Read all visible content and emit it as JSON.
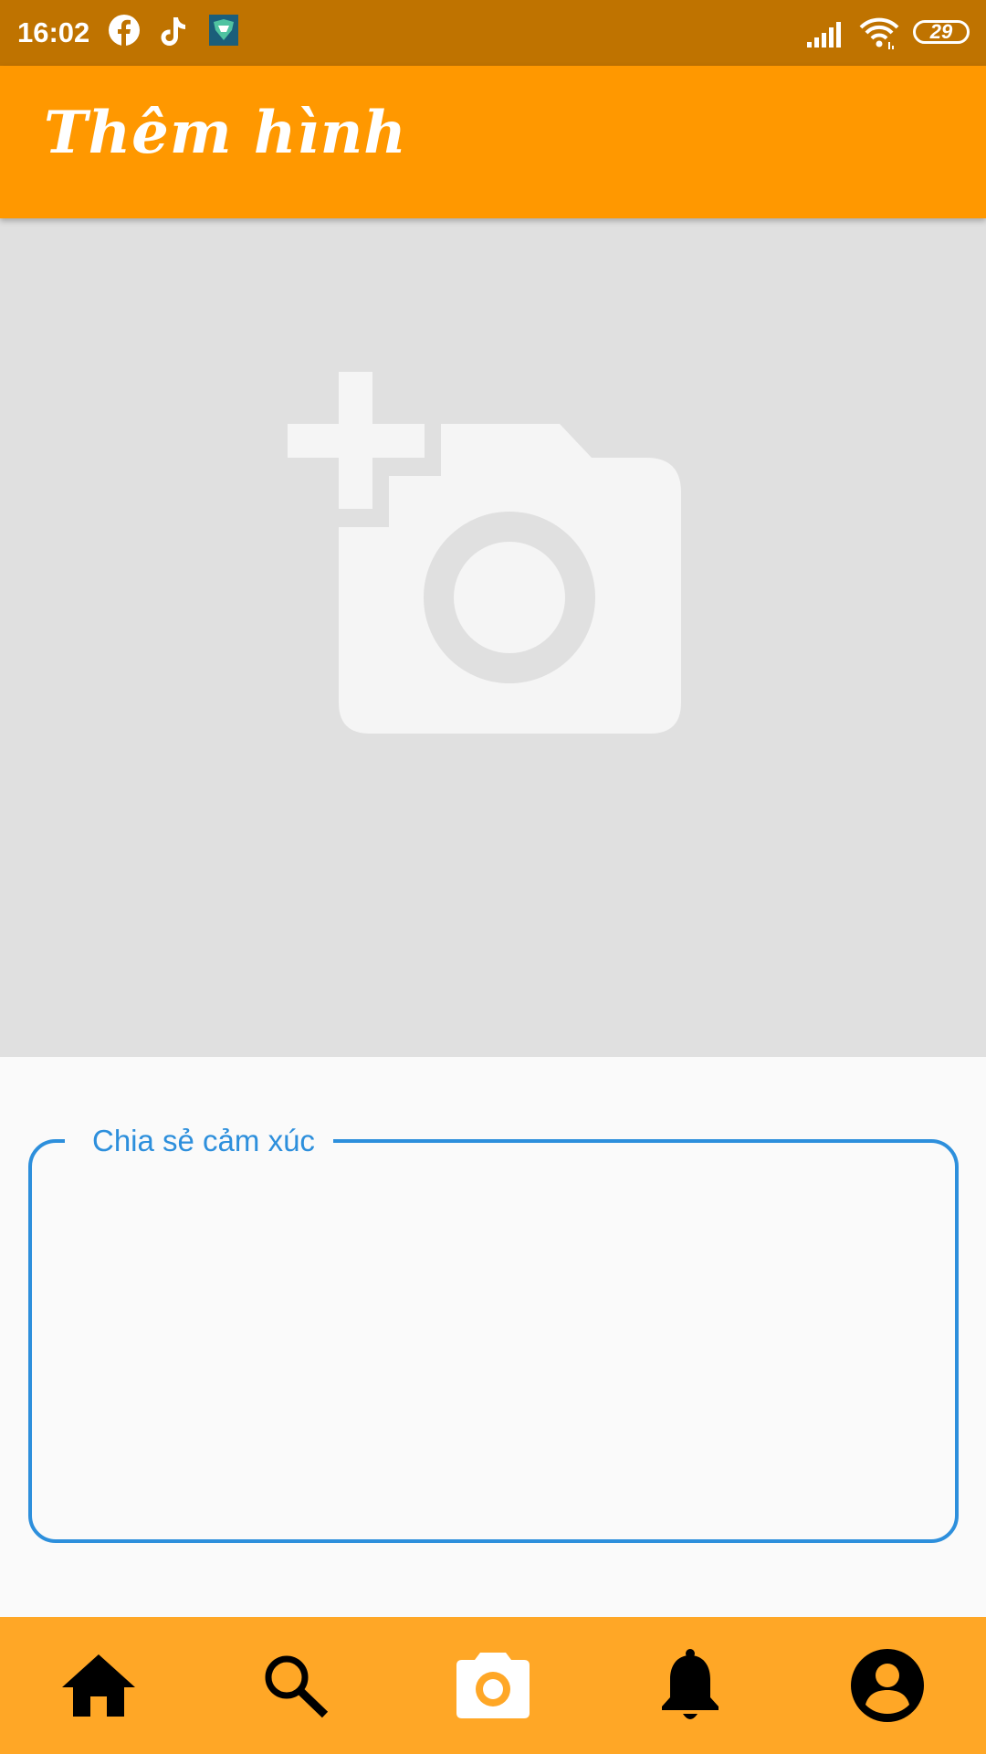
{
  "status_bar": {
    "time": "16:02",
    "battery": "29",
    "notification_icons": [
      "facebook-icon",
      "tiktok-icon",
      "app-badge-icon"
    ],
    "system_icons": [
      "signal-icon",
      "wifi-icon",
      "battery-icon"
    ]
  },
  "app_bar": {
    "title": "Thêm hình"
  },
  "image_picker": {
    "icon": "add-photo-icon"
  },
  "caption": {
    "label": "Chia sẻ cảm xúc",
    "value": ""
  },
  "bottom_nav": {
    "items": [
      {
        "icon": "home-icon"
      },
      {
        "icon": "search-icon"
      },
      {
        "icon": "camera-icon",
        "active": true
      },
      {
        "icon": "bell-icon"
      },
      {
        "icon": "account-icon"
      }
    ]
  },
  "colors": {
    "status_bar": "#bf7300",
    "app_bar": "#ff9800",
    "nav_bar": "#ffa726",
    "field_accent": "#2d8fdc",
    "picker_background": "#e0e0e0"
  }
}
